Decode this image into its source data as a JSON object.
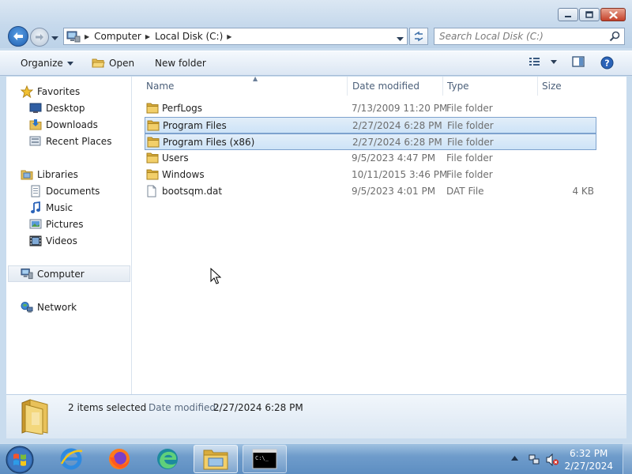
{
  "window": {
    "controls": {
      "minimize": "minimize",
      "maximize": "maximize",
      "close": "close"
    }
  },
  "address": {
    "crumbs": [
      "Computer",
      "Local Disk (C:)"
    ]
  },
  "search": {
    "placeholder": "Search Local Disk (C:)"
  },
  "toolbar": {
    "organize": "Organize",
    "open": "Open",
    "new_folder": "New folder"
  },
  "nav": {
    "favorites": "Favorites",
    "desktop": "Desktop",
    "downloads": "Downloads",
    "recent_places": "Recent Places",
    "libraries": "Libraries",
    "documents": "Documents",
    "music": "Music",
    "pictures": "Pictures",
    "videos": "Videos",
    "computer": "Computer",
    "network": "Network"
  },
  "columns": {
    "name": "Name",
    "date": "Date modified",
    "type": "Type",
    "size": "Size"
  },
  "files": [
    {
      "name": "PerfLogs",
      "date": "7/13/2009 11:20 PM",
      "type": "File folder",
      "size": "",
      "icon": "folder-icon",
      "selected": false
    },
    {
      "name": "Program Files",
      "date": "2/27/2024 6:28 PM",
      "type": "File folder",
      "size": "",
      "icon": "folder-icon",
      "selected": true
    },
    {
      "name": "Program Files (x86)",
      "date": "2/27/2024 6:28 PM",
      "type": "File folder",
      "size": "",
      "icon": "folder-icon",
      "selected": true
    },
    {
      "name": "Users",
      "date": "9/5/2023 4:47 PM",
      "type": "File folder",
      "size": "",
      "icon": "folder-icon",
      "selected": false
    },
    {
      "name": "Windows",
      "date": "10/11/2015 3:46 PM",
      "type": "File folder",
      "size": "",
      "icon": "folder-icon",
      "selected": false
    },
    {
      "name": "bootsqm.dat",
      "date": "9/5/2023 4:01 PM",
      "type": "DAT File",
      "size": "4 KB",
      "icon": "file-icon",
      "selected": false
    }
  ],
  "details": {
    "count": "2 items selected",
    "date_label": "Date modified:",
    "date_value": "2/27/2024 6:28 PM"
  },
  "taskbar": {
    "time": "6:32 PM",
    "date": "2/27/2024"
  },
  "colors": {
    "selection_bg": "#cde3f7",
    "selection_border": "#7da2ce",
    "folder_yellow": "#e8c15a"
  }
}
